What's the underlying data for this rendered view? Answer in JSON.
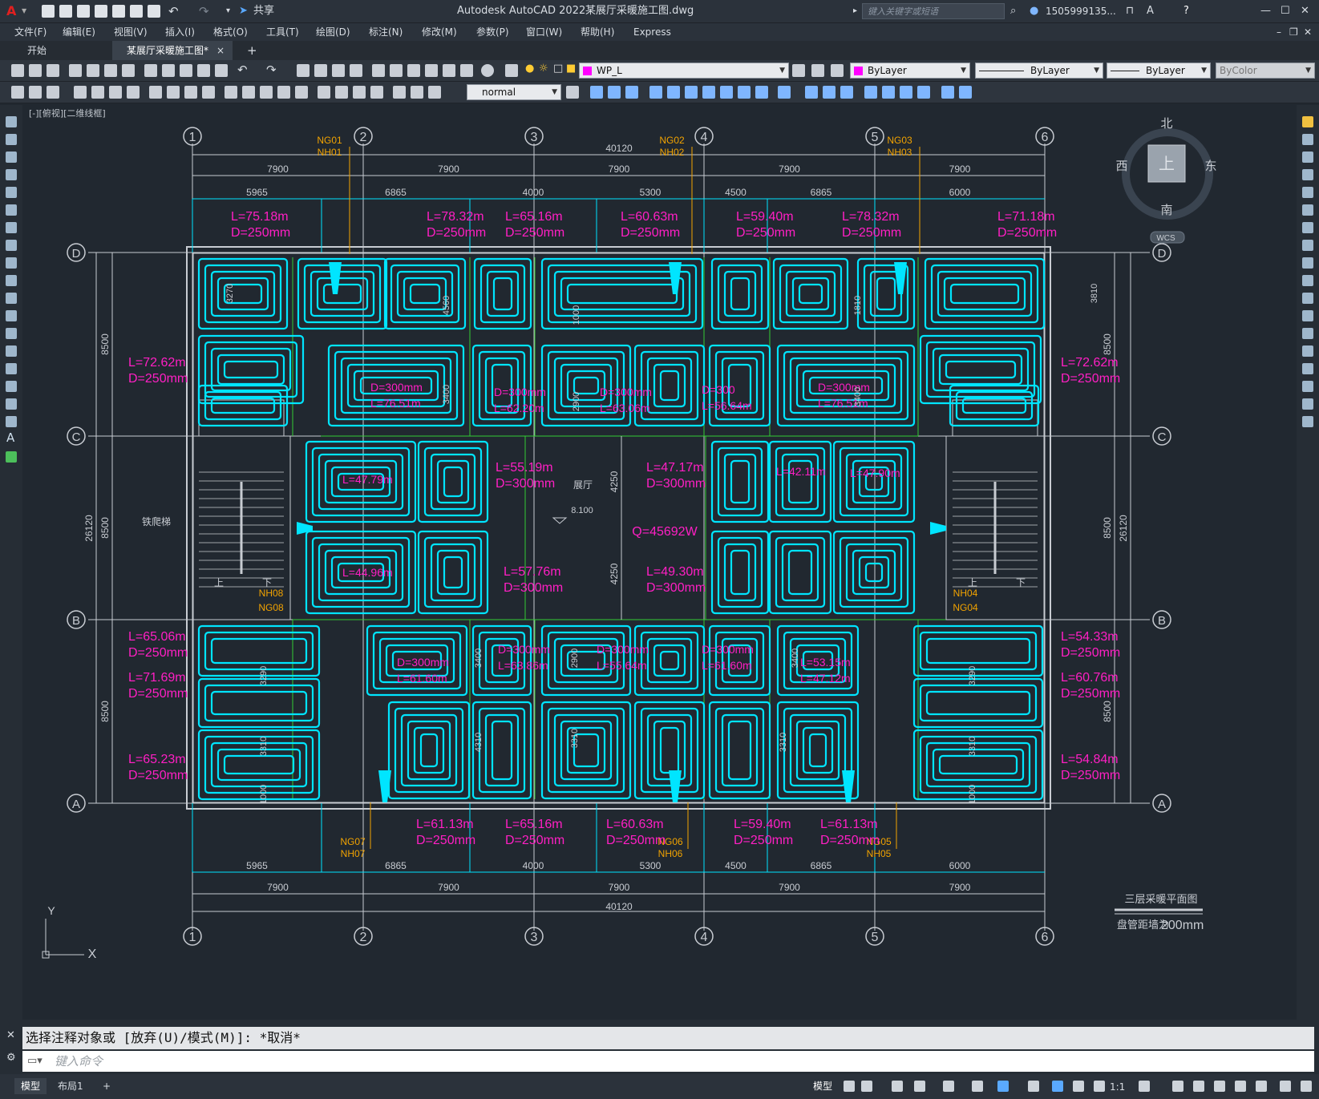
{
  "titlebar": {
    "app_title": "Autodesk AutoCAD 2022",
    "file_title": "某展厅采暖施工图.dwg",
    "share_label": "共享",
    "search_placeholder": "键入关键字或短语",
    "user_name": "1505999135...",
    "logo": "A"
  },
  "menu": {
    "items": [
      "文件(F)",
      "编辑(E)",
      "视图(V)",
      "插入(I)",
      "格式(O)",
      "工具(T)",
      "绘图(D)",
      "标注(N)",
      "修改(M)",
      "参数(P)",
      "窗口(W)",
      "帮助(H)",
      "Express"
    ]
  },
  "tabs": {
    "start": "开始",
    "active": "某展厅采暖施工图*",
    "close": "×",
    "add": "+"
  },
  "toolbar": {
    "layer_value": "WP_L",
    "color_value": "ByLayer",
    "linetype_value": "ByLayer",
    "lineweight_value": "ByLayer",
    "plotstyle_value": "ByColor",
    "textstyle_value": "normal",
    "layer_color": "#ff00ff"
  },
  "viewport": {
    "label": "[-][俯视][二维线框]",
    "background": "#212830"
  },
  "viewcube": {
    "north": "北",
    "south": "南",
    "east": "东",
    "west": "西",
    "top": "上",
    "wcs": "WCS"
  },
  "drawing": {
    "grid_cols": [
      "1",
      "2",
      "3",
      "4",
      "5",
      "6"
    ],
    "grid_rows": [
      "D",
      "C",
      "B",
      "A"
    ],
    "total_width": "40120",
    "col_spacing": [
      "7900",
      "7900",
      "7900",
      "7900",
      "7900"
    ],
    "sub_spacing": [
      "5965",
      "6865",
      "4000",
      "5300",
      "4500",
      "6865",
      "6000"
    ],
    "total_height": "26120",
    "row_spacing": [
      "8500",
      "8500",
      "8500"
    ],
    "misc_dims": [
      "3810",
      "3270",
      "4560",
      "1000",
      "1810",
      "3400",
      "2900",
      "3400",
      "4250",
      "4250",
      "3290",
      "3400",
      "2900",
      "3400",
      "3290",
      "3310",
      "3310",
      "4310",
      "3310",
      "3310",
      "1000",
      "1000"
    ],
    "manifolds_top": [
      {
        "ng": "NG01",
        "nh": "NH01"
      },
      {
        "ng": "NG02",
        "nh": "NH02"
      },
      {
        "ng": "NG03",
        "nh": "NH03"
      }
    ],
    "manifolds_bottom": [
      {
        "ng": "NG07",
        "nh": "NH07"
      },
      {
        "ng": "NG06",
        "nh": "NH06"
      },
      {
        "ng": "NG05",
        "nh": "NH05"
      }
    ],
    "manifold_side_left": {
      "nh": "NH08",
      "ng": "NG08"
    },
    "manifold_side_right": {
      "nh": "NH04",
      "ng": "NG04"
    },
    "loops_top": [
      {
        "l": "L=75.18m",
        "d": "D=250mm"
      },
      {
        "l": "L=78.32m",
        "d": "D=250mm"
      },
      {
        "l": "L=65.16m",
        "d": "D=250mm"
      },
      {
        "l": "L=60.63m",
        "d": "D=250mm"
      },
      {
        "l": "L=59.40m",
        "d": "D=250mm"
      },
      {
        "l": "L=78.32m",
        "d": "D=250mm"
      },
      {
        "l": "L=71.18m",
        "d": "D=250mm"
      }
    ],
    "loops_bottom": [
      {
        "l": "L=61.13m",
        "d": "D=250mm"
      },
      {
        "l": "L=65.16m",
        "d": "D=250mm"
      },
      {
        "l": "L=60.63m",
        "d": "D=250mm"
      },
      {
        "l": "L=59.40m",
        "d": "D=250mm"
      },
      {
        "l": "L=61.13m",
        "d": "D=250mm"
      }
    ],
    "loops_left": [
      {
        "l": "L=72.62m",
        "d": "D=250mm"
      },
      {
        "l": "L=65.06m",
        "d": "D=250mm"
      },
      {
        "l": "L=71.69m",
        "d": "D=250mm"
      },
      {
        "l": "L=65.23m",
        "d": "D=250mm"
      }
    ],
    "loops_right": [
      {
        "l": "L=72.62m",
        "d": "D=250mm"
      },
      {
        "l": "L=54.33m",
        "d": "D=250mm"
      },
      {
        "l": "L=60.76m",
        "d": "D=250mm"
      },
      {
        "l": "L=54.84m",
        "d": "D=250mm"
      }
    ],
    "loops_inner": [
      {
        "l": "L=55.19m",
        "d": "D=300mm"
      },
      {
        "l": "L=47.17m",
        "d": "D=300mm"
      },
      {
        "l": "L=57.76m",
        "d": "D=300mm"
      },
      {
        "l": "L=49.30m",
        "d": "D=300mm"
      }
    ],
    "inner_overlaps": [
      "D=300mm",
      "L=76.51m",
      "D=300mm",
      "L=62.20m",
      "D=300mm",
      "L=63.06m",
      "D=300",
      "L=56.64m",
      "D=300mm",
      "L=76.51m",
      "D=300mm",
      "L=61.60m",
      "D=300mm",
      "L=63.86m",
      "D=300mm",
      "L=55.64m",
      "D=300mm",
      "L=61.60m",
      "L=53.15m",
      "L=47.12m",
      "L=47.79m",
      "L=44.96m",
      "L=42.11m",
      "L=47.90m"
    ],
    "heat_load": "Q=45692W",
    "hall_label": "展厅",
    "elevation": "8.100",
    "stair_label": "铁爬梯",
    "stair_up": "上",
    "stair_down": "下",
    "drawing_title": "三层采暖平面图",
    "drawing_note_prefix": "盘管距墙为",
    "drawing_note_value": "200mm",
    "ucs_y": "Y",
    "ucs_x": "X"
  },
  "colors": {
    "pipe": "#00e5ff",
    "annotation": "#ff1fc4",
    "grid_line": "#c8ccd2",
    "manifold_label": "#f2a300",
    "room_line": "#33cc33"
  },
  "command": {
    "history": "选择注释对象或 [放弃(U)/模式(M)]: *取消*",
    "input_placeholder": "键入命令"
  },
  "statusbar": {
    "tab_model": "模型",
    "tab_layout": "布局1",
    "add": "+",
    "model_btn": "模型",
    "scale": "1:1"
  }
}
